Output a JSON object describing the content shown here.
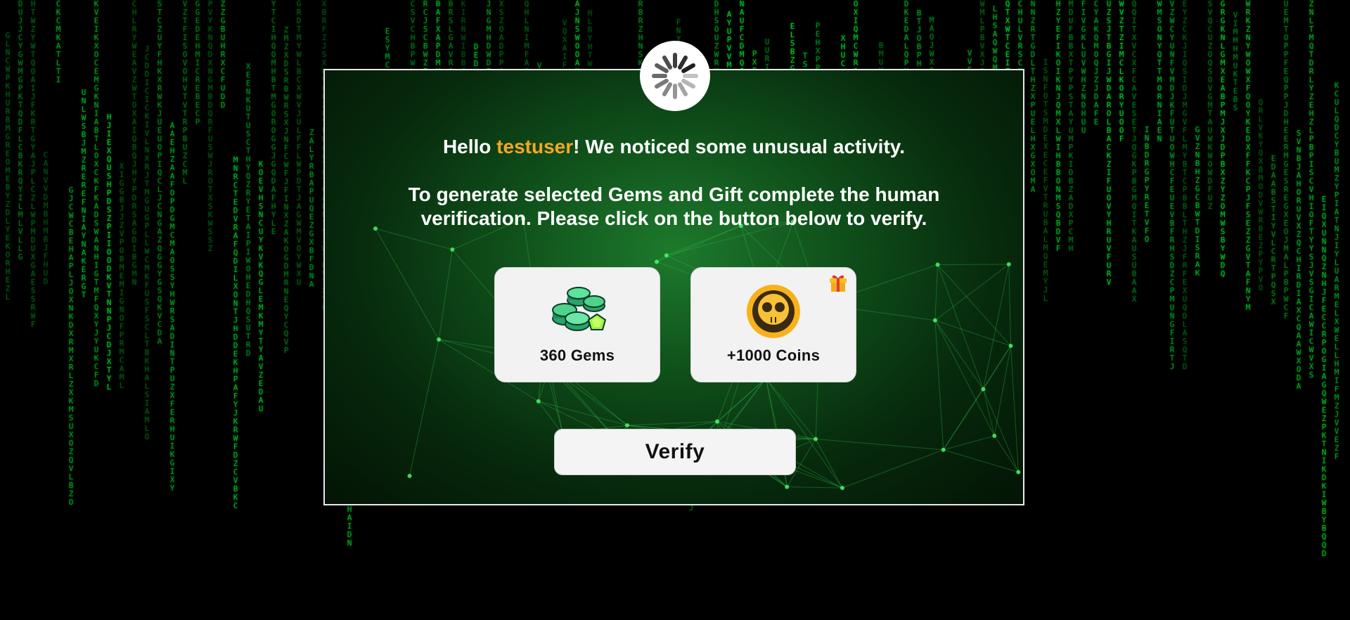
{
  "colors": {
    "background": "#000000",
    "matrix_green": "#00d42a",
    "modal_green": "#0f4e1a",
    "username_accent": "#f5a623",
    "card_bg": "#f2f2f2"
  },
  "dialog": {
    "greeting_prefix": "Hello ",
    "username": "testuser",
    "greeting_suffix": "! We noticed some unusual activity.",
    "instructions_line1": "To generate selected Gems and Gift complete the human",
    "instructions_line2": "verification. Please click on the button below to verify."
  },
  "rewards": [
    {
      "label": "360 Gems",
      "icon": "gems-icon"
    },
    {
      "label": "+1000 Coins",
      "icon": "coin-skull-icon",
      "badge": "gift-icon"
    }
  ],
  "verify_button": {
    "label": "Verify"
  },
  "spinner": {
    "icon": "loading-spinner-icon"
  }
}
